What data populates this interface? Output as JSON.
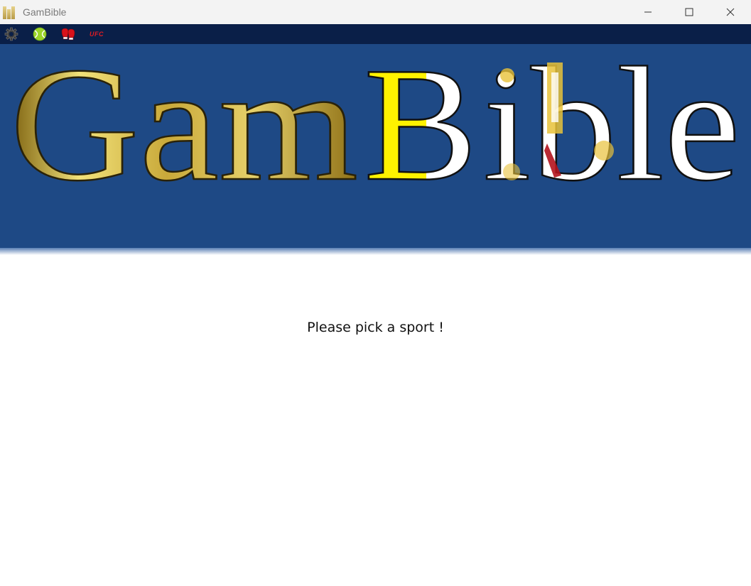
{
  "window": {
    "title": "GamBible"
  },
  "toolbar": {
    "items": [
      {
        "icon": "gear-icon",
        "label": "Settings"
      },
      {
        "icon": "tennis-ball-icon",
        "label": "Tennis"
      },
      {
        "icon": "boxing-gloves-icon",
        "label": "Boxing"
      },
      {
        "icon": "ufc-icon",
        "label": "UFC",
        "text": "UFC"
      }
    ]
  },
  "banner": {
    "logo_text": "GamBible",
    "background_color": "#1e4985"
  },
  "main": {
    "prompt": "Please pick a sport !"
  },
  "colors": {
    "toolbar_bg": "#0a1f48",
    "banner_bg": "#1e4985",
    "gold": "#c9a93a",
    "yellow": "#fff200",
    "white": "#ffffff"
  }
}
